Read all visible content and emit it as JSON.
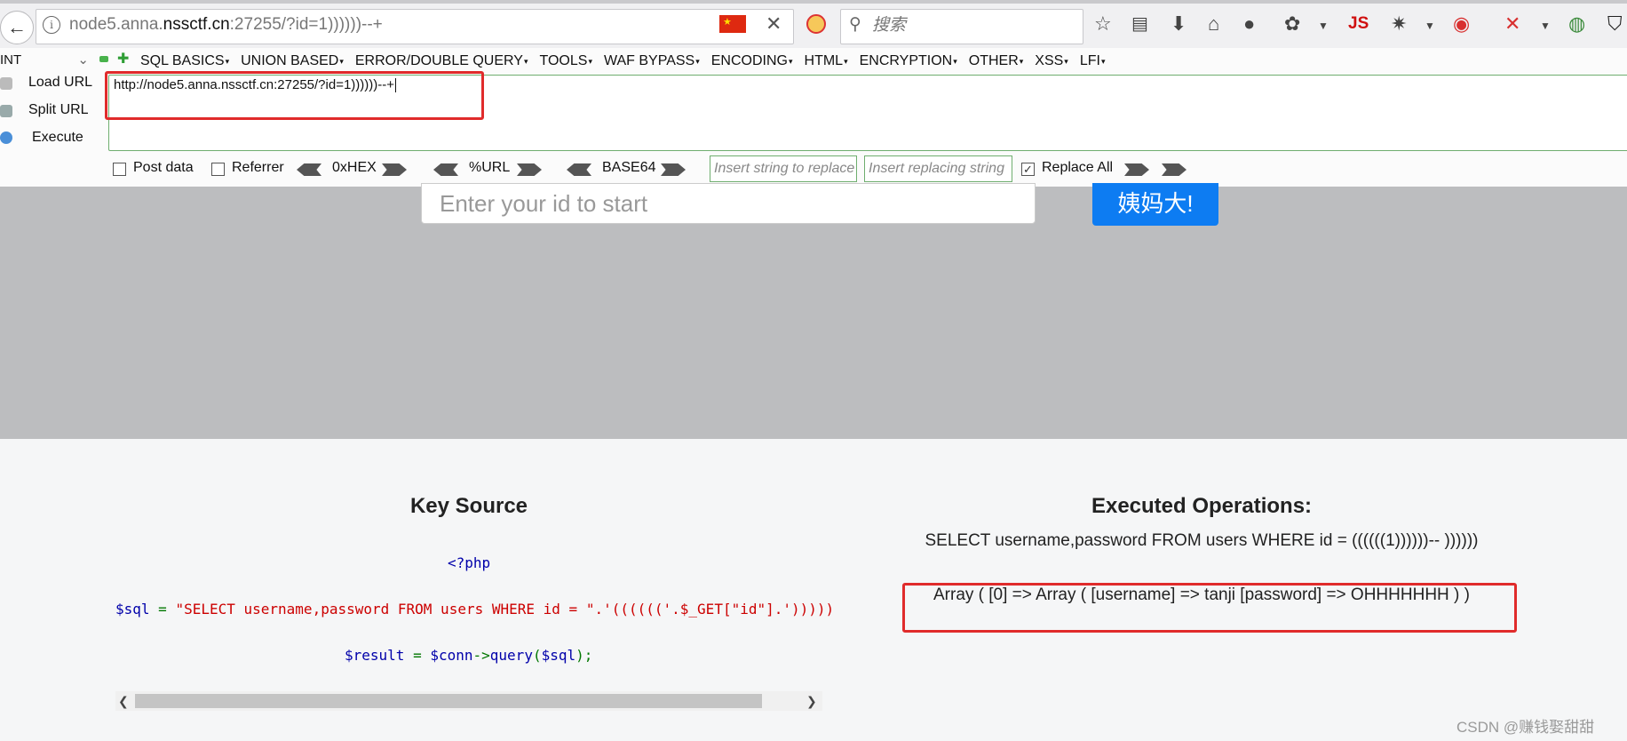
{
  "browser": {
    "url_prefix": "node5.anna.",
    "url_domain": "nssctf.cn",
    "url_suffix": ":27255/?id=1))))))--+",
    "search_placeholder": "搜索",
    "js_label": "JS"
  },
  "hackbar": {
    "method": "INT",
    "menus": [
      "SQL BASICS",
      "UNION BASED",
      "ERROR/DOUBLE QUERY",
      "TOOLS",
      "WAF BYPASS",
      "ENCODING",
      "HTML",
      "ENCRYPTION",
      "OTHER",
      "XSS",
      "LFI"
    ],
    "load_url": "Load URL",
    "split_url": "Split URL",
    "execute": "Execute",
    "url_value": "http://node5.anna.nssctf.cn:27255/?id=1))))))--+",
    "post_data": "Post data",
    "referrer": "Referrer",
    "hex": "0xHEX",
    "url_enc": "%URL",
    "base64": "BASE64",
    "replace_placeholder": "Insert string to replace",
    "replacing_placeholder": "Insert replacing string",
    "replace_all": "Replace All",
    "replace_all_checked": true,
    "check_mark": "✓"
  },
  "page": {
    "id_placeholder": "Enter your id to start",
    "go_button": "姨妈大!",
    "key_source_title": "Key Source",
    "code": {
      "line1": "<?php",
      "sql_var": "$sql",
      "eq": " = ",
      "sql_string": "\"SELECT username,password FROM users WHERE id = \"",
      "concat1": ".'((((((",
      "get_part1": "'.$_GET[",
      "get_key": "\"id\"",
      "get_part2": "].')))))",
      "result_var": "$result",
      "conn_var": "$conn",
      "arrow": "->",
      "method": "query",
      "call_open": "(",
      "call_arg": "$sql",
      "call_close": ");"
    },
    "exec_title": "Executed Operations:",
    "exec_sql": "SELECT username,password FROM users WHERE id = ((((((1))))))-- ))))))",
    "exec_result": "Array ( [0] => Array ( [username] => tanji [password] => OHHHHHHH ) )"
  },
  "watermark": "CSDN @赚钱娶甜甜"
}
